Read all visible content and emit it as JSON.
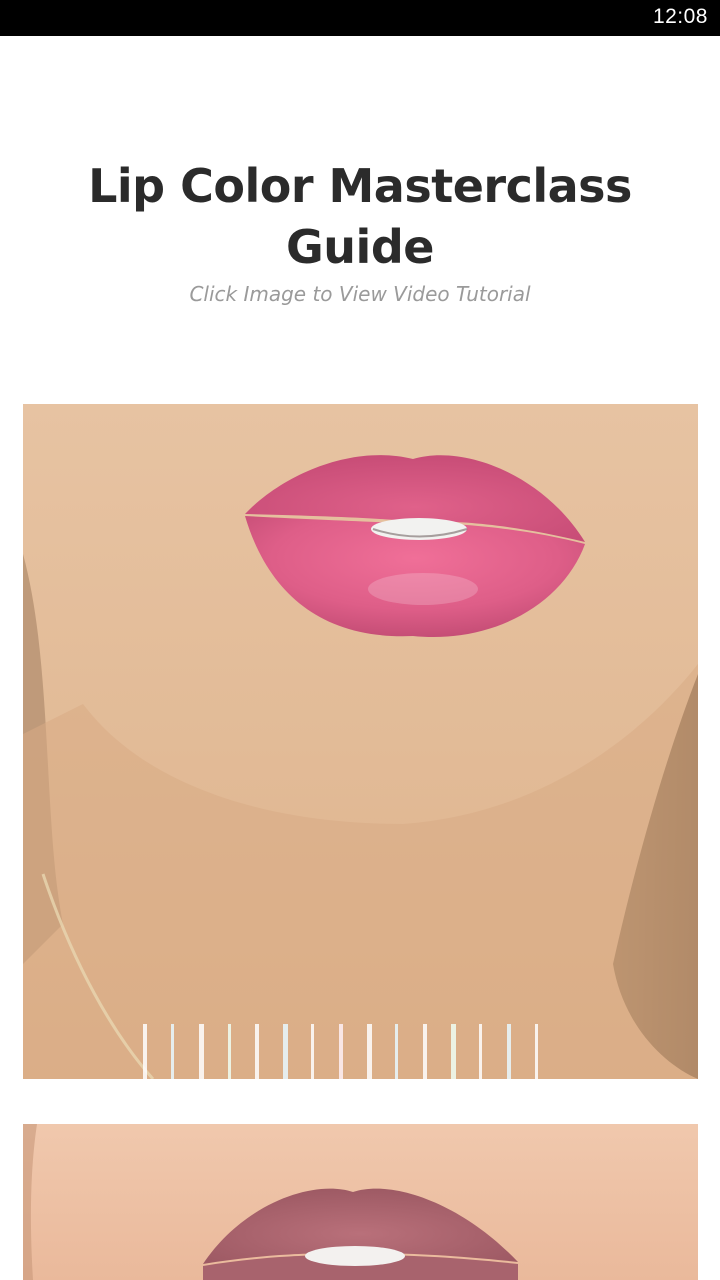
{
  "status_bar": {
    "time": "12:08"
  },
  "header": {
    "title": "Lip Color Masterclass Guide",
    "subtitle": "Click Image to View Video Tutorial"
  },
  "tutorials": [
    {
      "image": "lip-closeup-pink-glossy-photo"
    },
    {
      "image": "lip-closeup-mauve-matte-photo"
    }
  ],
  "colors": {
    "status_bar_bg": "#000000",
    "title_text": "#2b2b2b",
    "subtitle_text": "#9a9a9a",
    "background": "#ffffff"
  }
}
